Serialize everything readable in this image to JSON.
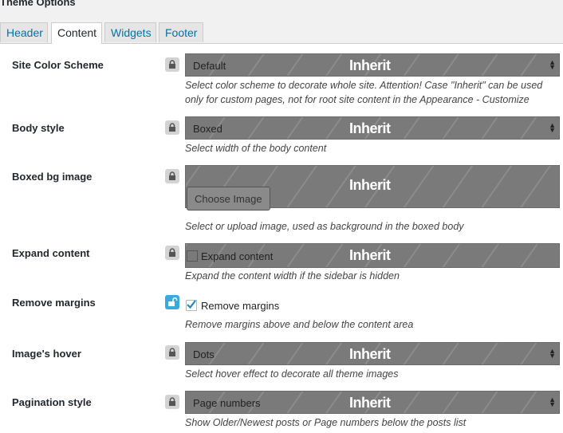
{
  "panel": {
    "title": "Theme Options"
  },
  "tabs": [
    {
      "label": "Header",
      "active": false
    },
    {
      "label": "Content",
      "active": true
    },
    {
      "label": "Widgets",
      "active": false
    },
    {
      "label": "Footer",
      "active": false
    }
  ],
  "options": {
    "color_scheme": {
      "label": "Site Color Scheme",
      "value": "Default",
      "inherit": "Inherit",
      "description": "Select color scheme to decorate whole site. Attention! Case \"Inherit\" can be used only for custom pages, not for root site content in the Appearance - Customize"
    },
    "body_style": {
      "label": "Body style",
      "value": "Boxed",
      "inherit": "Inherit",
      "description": "Select width of the body content"
    },
    "boxed_bg": {
      "label": "Boxed bg image",
      "button": "Choose Image",
      "inherit": "Inherit",
      "description": "Select or upload image, used as background in the boxed body"
    },
    "expand_content": {
      "label": "Expand content",
      "checkbox_label": "Expand content",
      "checked": false,
      "inherit": "Inherit",
      "description": "Expand the content width if the sidebar is hidden"
    },
    "remove_margins": {
      "label": "Remove margins",
      "checkbox_label": "Remove margins",
      "checked": true,
      "locked": false,
      "description": "Remove margins above and below the content area"
    },
    "image_hover": {
      "label": "Image's hover",
      "value": "Dots",
      "inherit": "Inherit",
      "description": "Select hover effect to decorate all theme images"
    },
    "pagination": {
      "label": "Pagination style",
      "value": "Page numbers",
      "inherit": "Inherit",
      "description": "Show Older/Newest posts or Page numbers below the posts list"
    }
  },
  "icons": {
    "lock": "lock-icon",
    "unlock": "unlock-icon",
    "select_arrows": "updown-arrows-icon",
    "check": "checkmark-icon"
  },
  "colors": {
    "link_blue": "#0073aa",
    "inherit_overlay": "#7a7a7a",
    "unlock_blue": "#3aa9dc",
    "check_blue": "#1e8cbe"
  }
}
